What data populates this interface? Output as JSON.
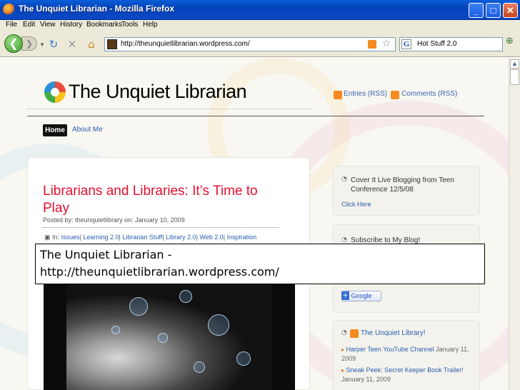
{
  "window": {
    "title": "The Unquiet Librarian - Mozilla Firefox",
    "minimize": "_",
    "maximize": "□",
    "close": "✕"
  },
  "menu": [
    "File",
    "Edit",
    "View",
    "History",
    "Bookmarks",
    "Tools",
    "Help"
  ],
  "nav": {
    "back_glyph": "❮",
    "forward_glyph": "❯",
    "url": "http://theunquietlibrarian.wordpress.com/",
    "search_value": "Hot Stuff 2.0"
  },
  "site": {
    "title": "The Unquiet Librarian",
    "feed_entries": "Entries (RSS)",
    "feed_comments": "Comments (RSS)",
    "nav_items": [
      "Home",
      "About Me"
    ]
  },
  "post": {
    "title": "Librarians and Libraries: It’s Time to Play",
    "meta": "Posted by: theunquietlibrary on: January 10, 2009",
    "in_label": "In:",
    "categories": [
      "Issues",
      "Learning 2.0",
      "Librarian Stuff",
      "Library 2.0",
      "Web 2.0",
      "Inspiration"
    ]
  },
  "sidebar": {
    "box1_title": "Cover It Live Blogging from Teen Conference 12/5/08",
    "box1_link": "Click Here",
    "box2_title": "Subscribe to My Blog!",
    "google_button": "Google",
    "box3_title": "The Unquiet Library!",
    "box3_items": [
      {
        "link": "Harper Teen YouTube Channel",
        "date": "January 11, 2009"
      },
      {
        "link": "Sneak Peek: Secret Keeper Book Trailer!",
        "date": "January 11, 2009"
      }
    ]
  },
  "caption": {
    "line1": "The Unquiet Librarian -",
    "line2": "http://theunquietlibrarian.wordpress.com/"
  },
  "colors": {
    "titlebar": "#0a5fd8",
    "post_title": "#e3112f",
    "link": "#2a5db0"
  }
}
